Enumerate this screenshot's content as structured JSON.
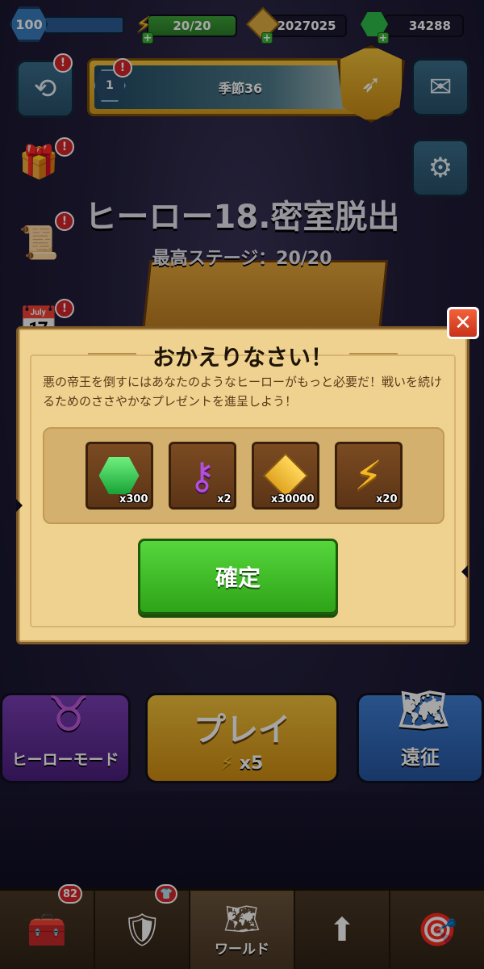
{
  "status": {
    "level": "100",
    "energy": "20/20",
    "gold": "2027025",
    "gems": "34288"
  },
  "season": {
    "rank": "1",
    "label": "季節36"
  },
  "stage": {
    "title": "ヒーロー18.密室脱出",
    "best": "最高ステージ：20/20"
  },
  "notifications": {
    "history": "!",
    "season": "!",
    "gift": "!",
    "scroll": "!",
    "calendar": "!"
  },
  "modal": {
    "title": "おかえりなさい！",
    "message": "悪の帝王を倒すにはあなたのようなヒーローがもっと必要だ！戦いを続けるためのささやかなプレゼントを進呈しよう！",
    "rewards": [
      {
        "icon": "gem-icon",
        "qty": "x300"
      },
      {
        "icon": "purple-key-icon",
        "qty": "x2"
      },
      {
        "icon": "gold-coin-icon",
        "qty": "x30000"
      },
      {
        "icon": "energy-bolt-icon",
        "qty": "x20"
      }
    ],
    "confirm": "確定",
    "close": "✕"
  },
  "modes": {
    "hero_mode": "ヒーローモード",
    "play": "プレイ",
    "play_cost": "x5",
    "expedition": "遠征"
  },
  "nav": {
    "chest_badge": "82",
    "armor_badge": "👕",
    "world": "ワールド"
  }
}
